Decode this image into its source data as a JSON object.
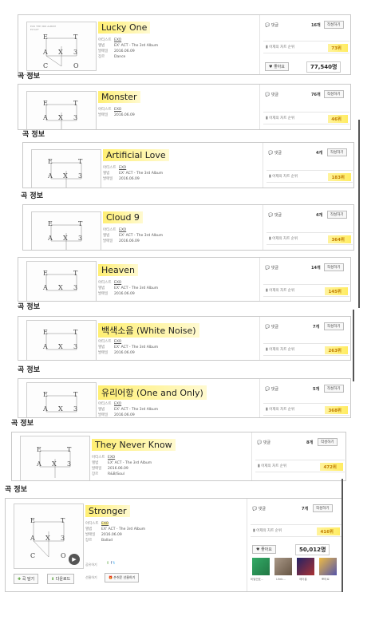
{
  "sections": {
    "label": "곡 정보"
  },
  "labels": {
    "artist": "아티스트",
    "album": "앨범",
    "release": "발매일",
    "genre": "장르",
    "comments": "댓글",
    "write": "작성하기",
    "rank": "어제의 차트 순위",
    "like": "좋아요",
    "play": "곡 담기",
    "download": "다운로드",
    "share": "공유하기",
    "gift": "선물하기",
    "gift_btn": "손쉬운 선물하기"
  },
  "cover": {
    "letters": [
      "E",
      "T",
      "A",
      "X",
      "3",
      "C",
      "O"
    ]
  },
  "songs": [
    {
      "title": "Lucky One",
      "artist": "EXO",
      "album": "EX' ACT - The 3rd Album",
      "release": "2016.06.09",
      "genre": "Dance",
      "comments": "16개",
      "rank": "73위",
      "likes": "77,540명"
    },
    {
      "title": "Monster",
      "artist": "EXO",
      "album": "EX' ACT - The 3rd Album",
      "release": "2016.06.09",
      "comments": "76개",
      "rank": "46위"
    },
    {
      "title": "Artificial Love",
      "artist": "EXO",
      "album": "EX' ACT - The 3rd Album",
      "release": "2016.06.09",
      "comments": "4개",
      "rank": "183위"
    },
    {
      "title": "Cloud 9",
      "artist": "EXO",
      "album": "EX' ACT - The 3rd Album",
      "release": "2016.06.09",
      "comments": "4개",
      "rank": "364위"
    },
    {
      "title": "Heaven",
      "artist": "EXO",
      "album": "EX' ACT - The 3rd Album",
      "release": "2016.06.09",
      "comments": "14개",
      "rank": "145위"
    },
    {
      "title": "백색소음 (White Noise)",
      "artist": "EXO",
      "album": "EX' ACT - The 3rd Album",
      "release": "2016.06.09",
      "comments": "7개",
      "rank": "263위"
    },
    {
      "title": "유리어항 (One and Only)",
      "artist": "EXO",
      "album": "EX' ACT - The 3rd Album",
      "release": "2016.06.09",
      "comments": "5개",
      "rank": "368위"
    },
    {
      "title": "They Never Know",
      "artist": "EXO",
      "album": "EX' ACT - The 3rd Album",
      "release": "2016.06.09",
      "genre": "R&B/Soul",
      "comments": "8개",
      "rank": "472위"
    },
    {
      "title": "Stronger",
      "artist": "EXO",
      "album": "EX' ACT - The 3rd Album",
      "release": "2016.06.09",
      "genre": "Ballad",
      "comments": "7개",
      "rank": "416위",
      "likes": "50,012명"
    }
  ],
  "related": [
    "비밀번호...",
    "Lifeb...",
    "제이홉",
    "뽀미로"
  ],
  "colors": {
    "highlight": "#fff176",
    "rank_text": "#c07b00",
    "border": "#c9c9c9"
  }
}
